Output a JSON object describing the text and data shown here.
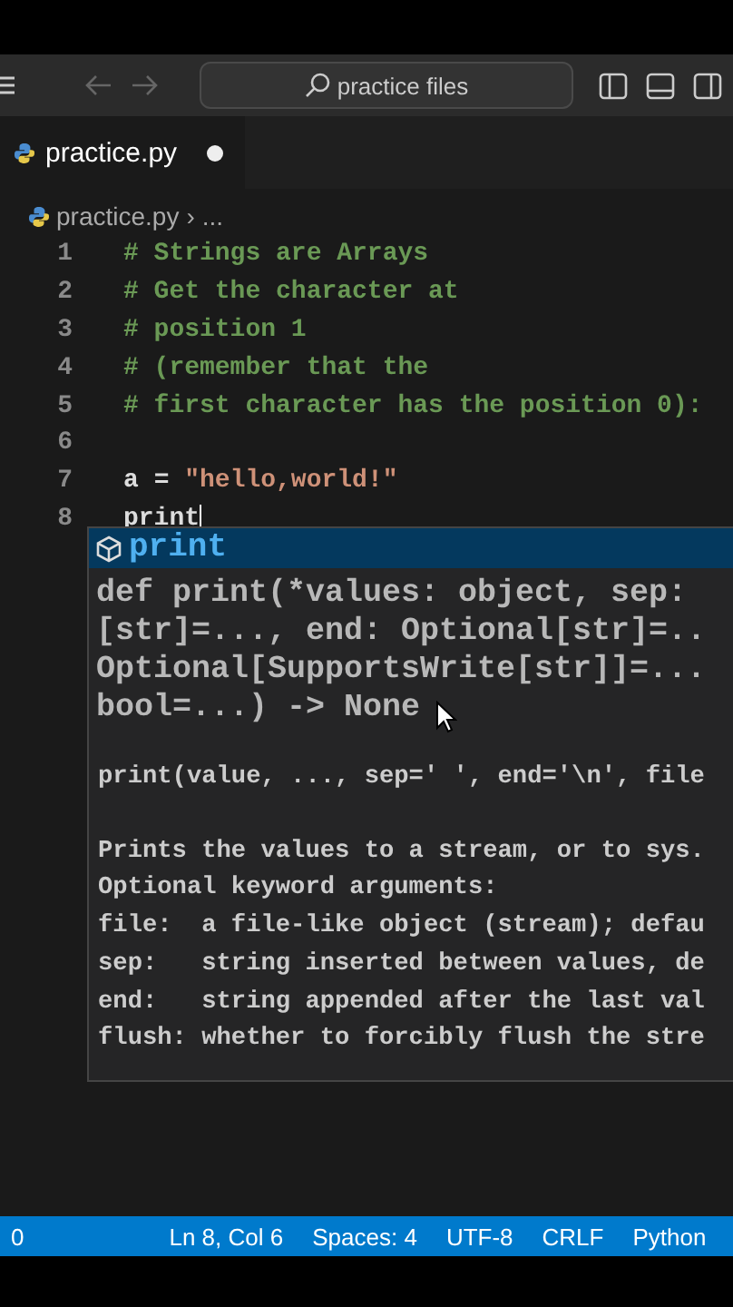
{
  "title_bar": {
    "search": "practice files"
  },
  "tabs": [
    {
      "label": "practice.py",
      "selected": true,
      "modified": true
    }
  ],
  "breadcrumb": {
    "separator": "›",
    "items": [
      "practice.py",
      "..."
    ]
  },
  "code_lines": [
    {
      "number": "1",
      "kind": "comment",
      "text": "# Strings are Arrays"
    },
    {
      "number": "2",
      "kind": "comment",
      "text": "# Get the character at"
    },
    {
      "number": "3",
      "kind": "comment",
      "text": "# position 1"
    },
    {
      "number": "4",
      "kind": "comment",
      "text": "# (remember that the"
    },
    {
      "number": "5",
      "kind": "comment",
      "text": "# first character has the position 0):"
    },
    {
      "number": "6",
      "kind": "blank"
    },
    {
      "number": "7",
      "kind": "assign",
      "name": "a",
      "op": "=",
      "value": "\"hello,world!\""
    },
    {
      "number": "8",
      "kind": "code",
      "text": "print",
      "cursor": true
    }
  ],
  "suggestion": {
    "label": "print",
    "selected": true,
    "signature": [
      "def print(*values: object, sep:",
      "[str]=..., end: Optional[str]=..",
      "Optional[SupportsWrite[str]]=...",
      "bool=...) -> None"
    ],
    "usage": "print(value, ..., sep=' ', end='\\n', file",
    "doc": [
      "Prints the values to a stream, or to sys.",
      "Optional keyword arguments:",
      "file:  a file-like object (stream); defau",
      "sep:   string inserted between values, de",
      "end:   string appended after the last val",
      "flush: whether to forcibly flush the stre"
    ]
  },
  "status_bar": [
    "0",
    "Ln 8, Col 6",
    "Spaces: 4",
    "UTF-8",
    "CRLF",
    "Python"
  ]
}
